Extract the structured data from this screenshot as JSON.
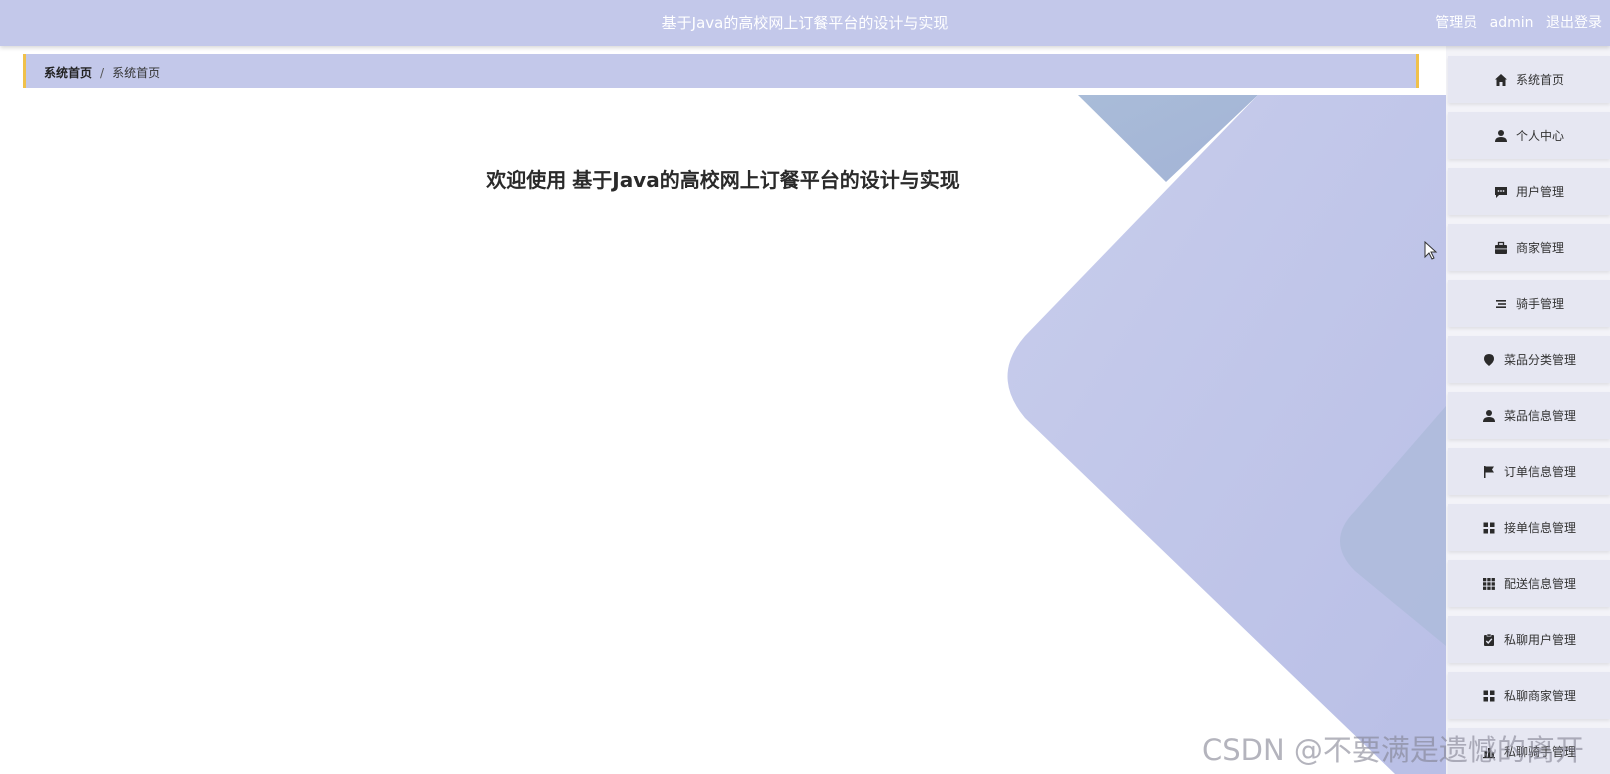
{
  "header": {
    "title": "基于Java的高校网上订餐平台的设计与实现",
    "role": "管理员",
    "username": "admin",
    "logout_label": "退出登录"
  },
  "breadcrumb": {
    "home": "系统首页",
    "current": "系统首页"
  },
  "welcome": {
    "prefix": "欢迎使用",
    "title": "基于Java的高校网上订餐平台的设计与实现"
  },
  "sidebar": {
    "items": [
      {
        "label": "系统首页",
        "icon": "home-icon"
      },
      {
        "label": "个人中心",
        "icon": "user-icon"
      },
      {
        "label": "用户管理",
        "icon": "chat-icon"
      },
      {
        "label": "商家管理",
        "icon": "briefcase-icon"
      },
      {
        "label": "骑手管理",
        "icon": "list-icon"
      },
      {
        "label": "菜品分类管理",
        "icon": "map-pin-icon"
      },
      {
        "label": "菜品信息管理",
        "icon": "user-icon"
      },
      {
        "label": "订单信息管理",
        "icon": "flag-icon"
      },
      {
        "label": "接单信息管理",
        "icon": "grid-icon"
      },
      {
        "label": "配送信息管理",
        "icon": "grid-nine-icon"
      },
      {
        "label": "私聊用户管理",
        "icon": "clipboard-check-icon"
      },
      {
        "label": "私聊商家管理",
        "icon": "grid-icon"
      },
      {
        "label": "私聊骑手管理",
        "icon": "bar-chart-icon"
      }
    ]
  },
  "watermark": "CSDN @不要满是遗憾的离开",
  "colors": {
    "header_bg": "#c3c8ea",
    "breadcrumb_accent": "#f0c14b",
    "sidebar_item_bg": "#e6e7f2"
  }
}
